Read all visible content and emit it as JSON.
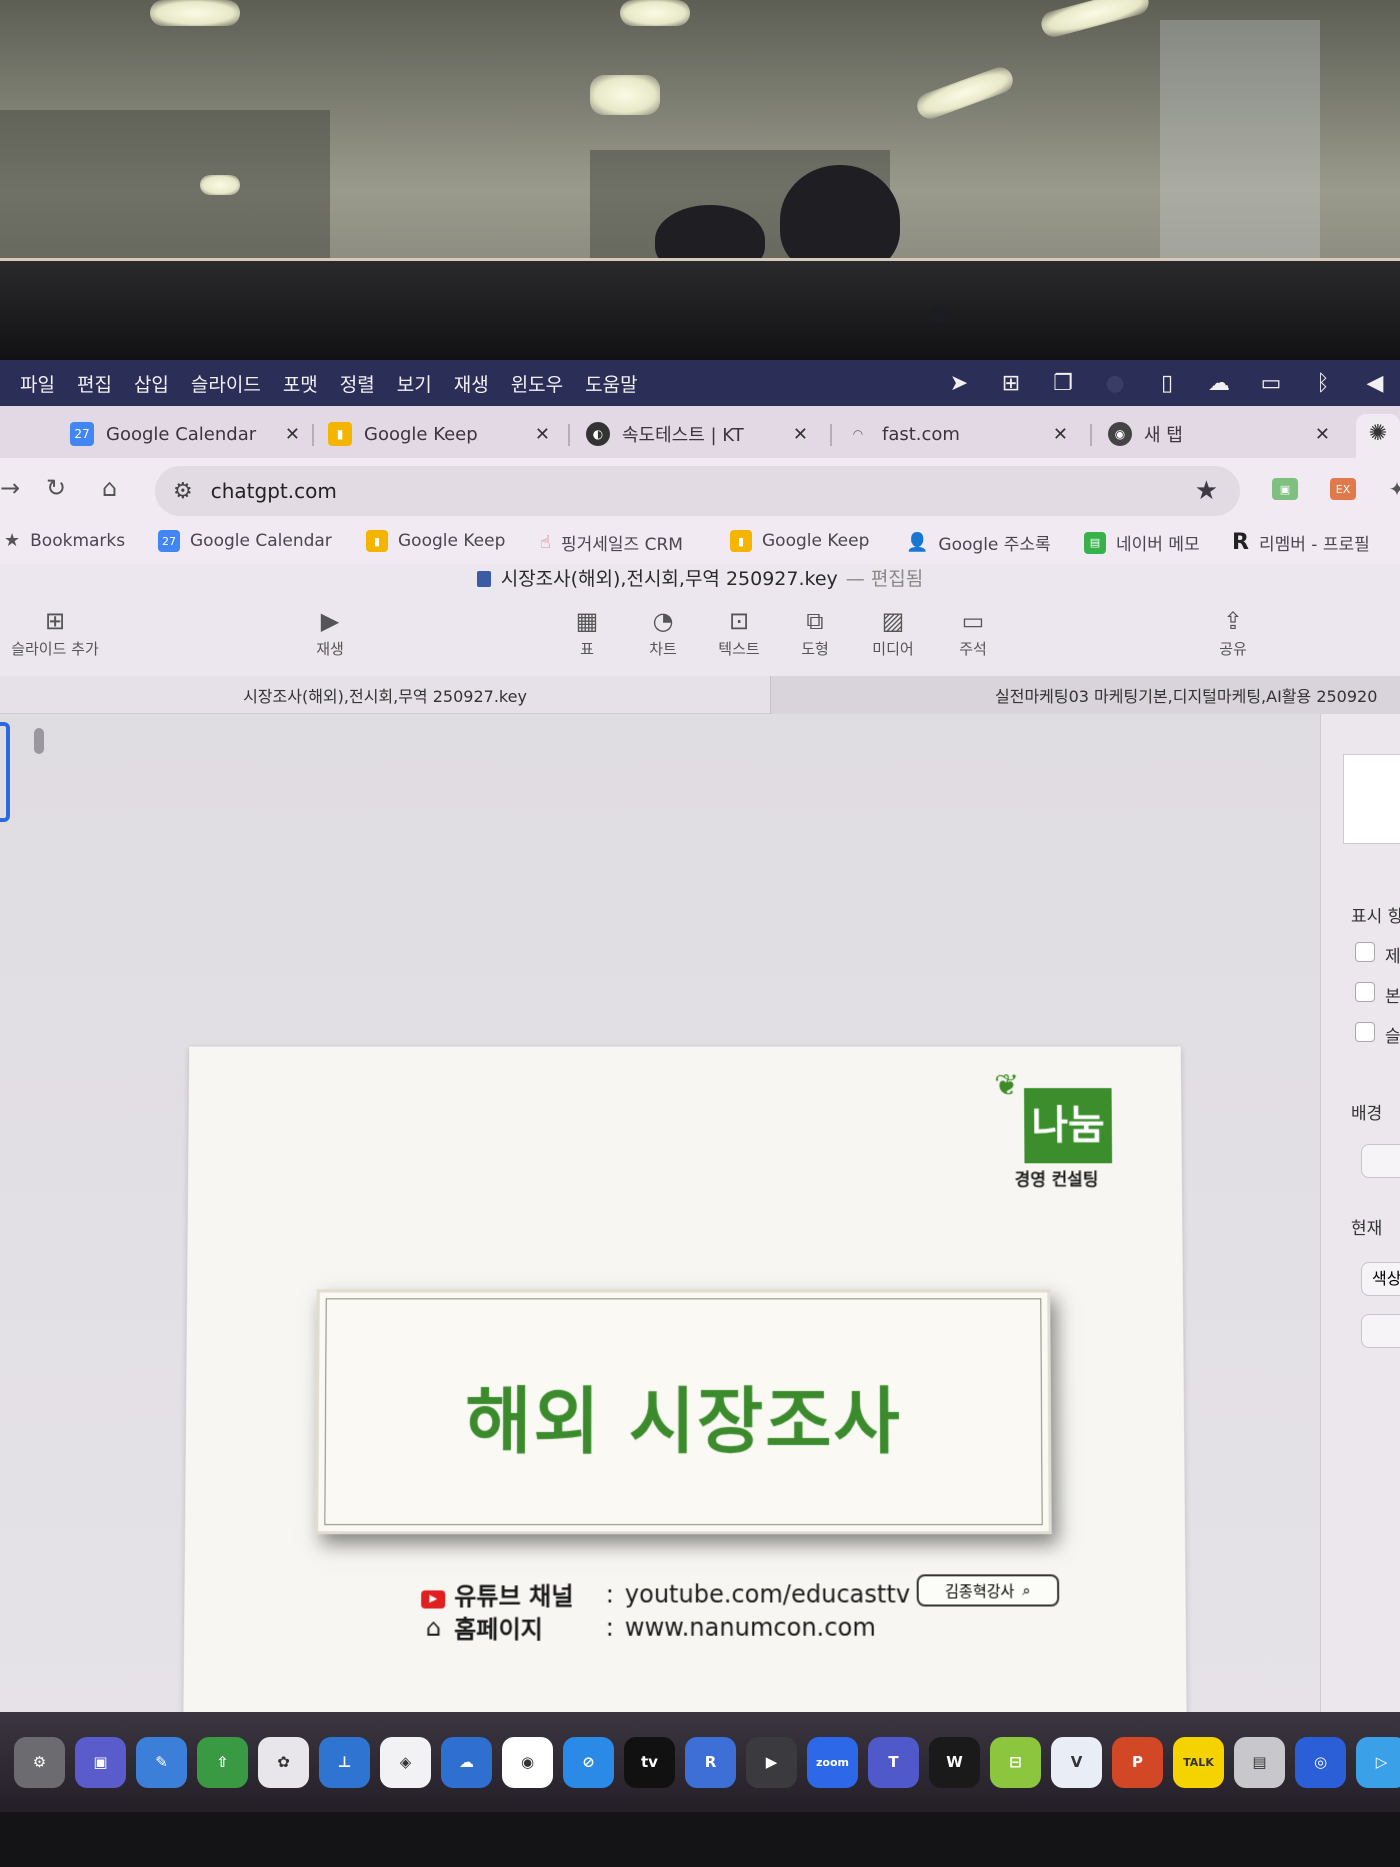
{
  "menubar": {
    "items": [
      "파일",
      "편집",
      "삽입",
      "슬라이드",
      "포맷",
      "정렬",
      "보기",
      "재생",
      "윈도우",
      "도움말"
    ],
    "status_icons": [
      "cursor-icon",
      "grid-icon",
      "stack-icon",
      "dot-icon",
      "note-icon",
      "cloud-icon",
      "display-icon",
      "bluetooth-icon",
      "volume-icon"
    ]
  },
  "tabs": [
    {
      "title": "Google Calendar",
      "favicon": "calendar-icon",
      "fav_text": "27",
      "fav_color": "#4285f4"
    },
    {
      "title": "Google Keep",
      "favicon": "keep-icon",
      "fav_text": "",
      "fav_color": "#f4b400"
    },
    {
      "title": "속도테스트 | KT",
      "favicon": "globe-icon",
      "fav_text": "",
      "fav_color": "#333333"
    },
    {
      "title": "fast.com",
      "favicon": "speed-icon",
      "fav_text": "",
      "fav_color": "#888888"
    },
    {
      "title": "새 탭",
      "favicon": "chrome-icon",
      "fav_text": "",
      "fav_color": "#444444"
    }
  ],
  "address": {
    "url": "chatgpt.com"
  },
  "bookmarks": [
    {
      "label": "Bookmarks",
      "icon": "star-icon"
    },
    {
      "label": "Google Calendar",
      "icon": "calendar-icon",
      "fav_text": "27"
    },
    {
      "label": "Google Keep",
      "icon": "keep-icon"
    },
    {
      "label": "핑거세일즈 CRM",
      "icon": "hand-icon"
    },
    {
      "label": "Google Keep",
      "icon": "keep-icon"
    },
    {
      "label": "Google 주소록",
      "icon": "contacts-icon"
    },
    {
      "label": "네이버 메모",
      "icon": "memo-icon"
    },
    {
      "label": "리멤버 - 프로필",
      "icon": "remember-icon"
    }
  ],
  "keynote": {
    "doc_title": "시장조사(해외),전시회,무역 250927.key",
    "edited_label": "— 편집됨",
    "toolbar": {
      "add_slide": "슬라이드 추가",
      "play": "재생",
      "table": "표",
      "chart": "차트",
      "text": "텍스트",
      "shape": "도형",
      "media": "미디어",
      "comment": "주석",
      "share": "공유"
    },
    "doc_tabs": [
      {
        "title": "시장조사(해외),전시회,무역 250927.key"
      },
      {
        "title": "실전마케팅03 마케팅기본,디지털마케팅,AI활용 250920"
      }
    ]
  },
  "slide": {
    "logo_text": "나눔",
    "logo_sub": "경영 컨설팅",
    "title": "해외 시장조사",
    "rows": [
      {
        "label": "유튜브 채널",
        "colon": ":",
        "value": "youtube.com/educasttv"
      },
      {
        "label": "홈페이지",
        "colon": ":",
        "value": "www.nanumcon.com"
      }
    ],
    "search_pill": "김종혁강사"
  },
  "inspector": {
    "section1": "표시 항",
    "check1": "제",
    "check2": "본",
    "check3": "슬",
    "section2": "배경",
    "section3": "현재",
    "field": "색상"
  },
  "dock": {
    "apps": [
      {
        "name": "system-settings-icon",
        "label": "⚙",
        "color": "#6b6b70"
      },
      {
        "name": "mirror-icon",
        "label": "▣",
        "color": "#5b5ccc"
      },
      {
        "name": "pen-icon",
        "label": "✎",
        "color": "#3b7fd8"
      },
      {
        "name": "share-icon",
        "label": "⇧",
        "color": "#3a9a44"
      },
      {
        "name": "photos-icon",
        "label": "✿",
        "color": "#e8e6ea"
      },
      {
        "name": "keynote-icon",
        "label": "⊥",
        "color": "#2f74d0"
      },
      {
        "name": "diamond-icon",
        "label": "◈",
        "color": "#f2f2f4"
      },
      {
        "name": "onedrive-icon",
        "label": "☁",
        "color": "#2f6fd0"
      },
      {
        "name": "chrome-icon",
        "label": "◉",
        "color": "#ffffff"
      },
      {
        "name": "safari-icon",
        "label": "⊘",
        "color": "#2a8ae6"
      },
      {
        "name": "appletv-icon",
        "label": "tv",
        "color": "#111111"
      },
      {
        "name": "remember-icon",
        "label": "R",
        "color": "#3d6fd6"
      },
      {
        "name": "imovie-icon",
        "label": "▶",
        "color": "#3b3b3f"
      },
      {
        "name": "zoom-icon",
        "label": "zoom",
        "color": "#2d68e8"
      },
      {
        "name": "teams-icon",
        "label": "T",
        "color": "#5059c9"
      },
      {
        "name": "webex-icon",
        "label": "W",
        "color": "#1a1a1a"
      },
      {
        "name": "drive-icon",
        "label": "⊟",
        "color": "#8cc63f"
      },
      {
        "name": "vrew-icon",
        "label": "V",
        "color": "#e9eef6"
      },
      {
        "name": "powerpoint-icon",
        "label": "P",
        "color": "#d24726"
      },
      {
        "name": "kakaotalk-icon",
        "label": "TALK",
        "color": "#f5d300"
      },
      {
        "name": "card-icon",
        "label": "▤",
        "color": "#c8c8cc"
      },
      {
        "name": "podcast-icon",
        "label": "◎",
        "color": "#2a5fd8"
      },
      {
        "name": "play-icon",
        "label": "▷",
        "color": "#3aa0e8"
      }
    ]
  }
}
